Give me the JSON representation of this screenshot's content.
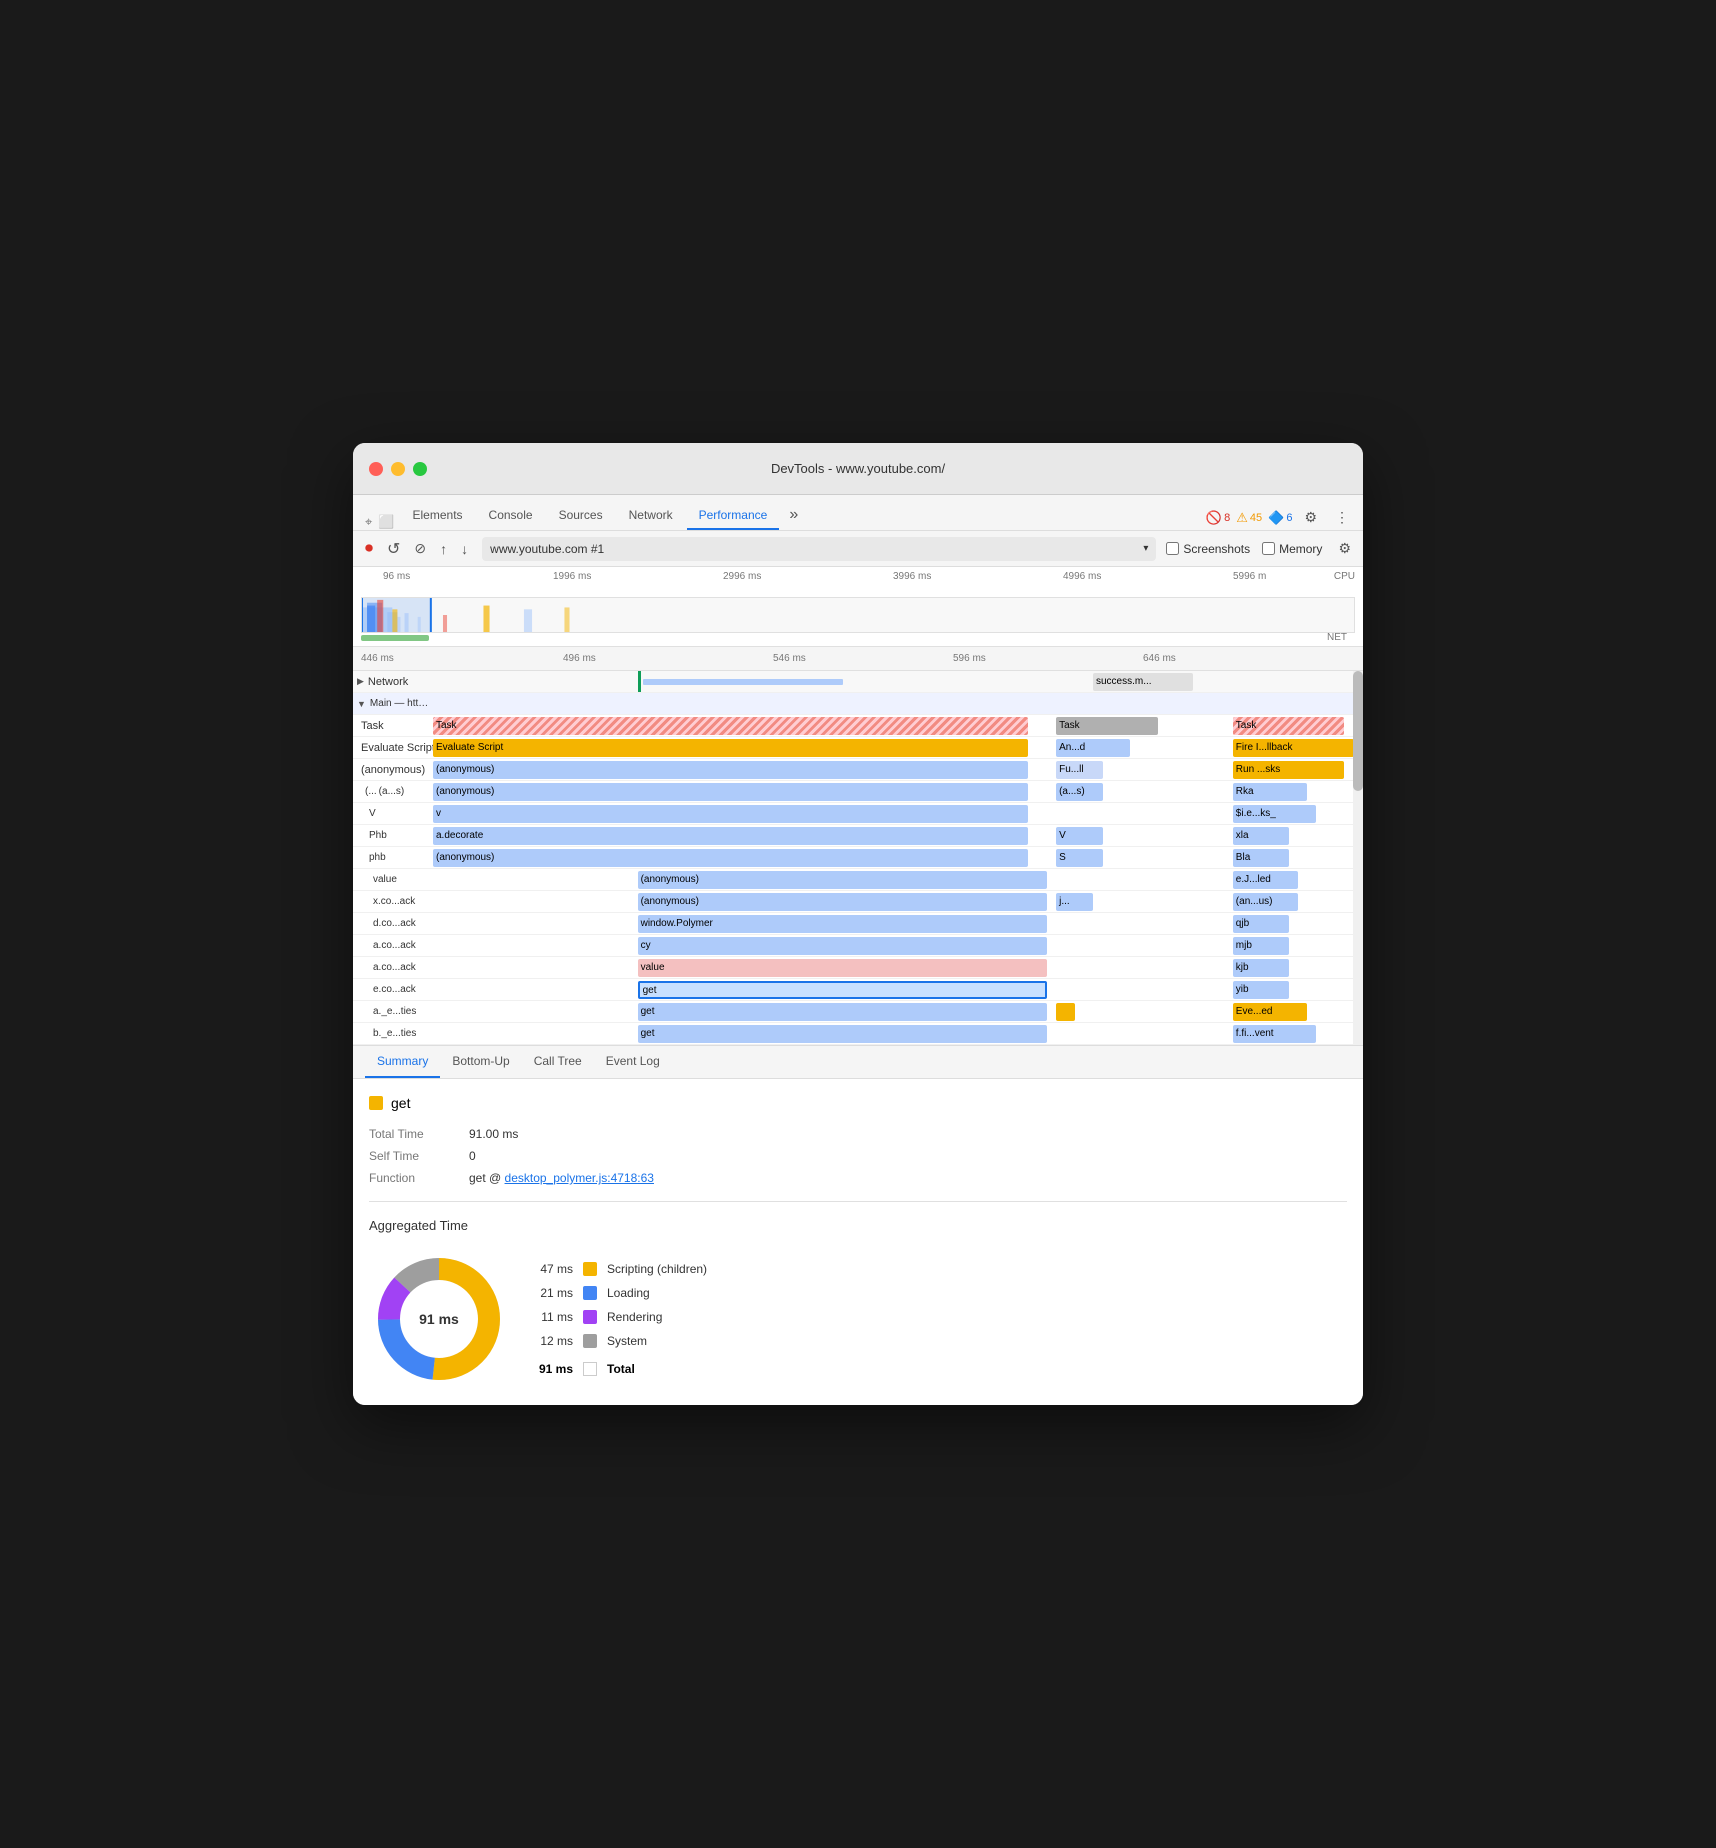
{
  "window": {
    "title": "DevTools - www.youtube.com/"
  },
  "nav_tabs": [
    {
      "label": "Elements",
      "active": false
    },
    {
      "label": "Console",
      "active": false
    },
    {
      "label": "Sources",
      "active": false
    },
    {
      "label": "Network",
      "active": false
    },
    {
      "label": "Performance",
      "active": true
    },
    {
      "label": "»",
      "active": false
    }
  ],
  "toolbar_right": {
    "errors_count": "8",
    "warnings_count": "45",
    "info_count": "6"
  },
  "recording_bar": {
    "url": "www.youtube.com #1",
    "screenshots_label": "Screenshots",
    "memory_label": "Memory"
  },
  "timeline": {
    "markers": [
      "96 ms",
      "1996 ms",
      "2996 ms",
      "3996 ms",
      "4996 ms",
      "5996 m"
    ],
    "bottom_markers": [
      "446 ms",
      "496 ms",
      "546 ms",
      "596 ms",
      "646 ms"
    ],
    "cpu_label": "CPU",
    "net_label": "NET"
  },
  "flamechart": {
    "network_label": "Network",
    "main_label": "Main — https://www.youtube.com/",
    "success_label": "success.m...",
    "rows": [
      {
        "label": "Task",
        "blocks": [
          {
            "text": "Task",
            "color": "task-striped",
            "left": "0%",
            "width": "66%"
          },
          {
            "text": "Task",
            "color": "task-gray",
            "left": "68%",
            "width": "12%"
          },
          {
            "text": "Task",
            "color": "task-striped",
            "left": "86%",
            "width": "13%"
          }
        ]
      },
      {
        "label": "Evaluate Script",
        "blocks": [
          {
            "text": "Evaluate Script",
            "color": "evaluate-script",
            "left": "0%",
            "width": "66%"
          },
          {
            "text": "An...d",
            "color": "anon-blue",
            "left": "68%",
            "width": "8%"
          },
          {
            "text": "Fire I...llback",
            "color": "evaluate-script",
            "left": "86%",
            "width": "13%"
          }
        ]
      },
      {
        "label": "(anonymous)",
        "blocks": [
          {
            "text": "(anonymous)",
            "color": "anon-blue",
            "left": "0%",
            "width": "66%"
          },
          {
            "text": "Fu...ll",
            "color": "fu-light",
            "left": "68%",
            "width": "5%"
          },
          {
            "text": "Run ...sks",
            "color": "run-tasks",
            "left": "86%",
            "width": "12%"
          }
        ]
      },
      {
        "label": "(...",
        "sub": "(a...s)",
        "blocks": [
          {
            "text": "(a...s)",
            "color": "anon-blue",
            "left": "68%",
            "width": "5%"
          },
          {
            "text": "Rka",
            "color": "anon-blue",
            "left": "88%",
            "width": "8%"
          }
        ]
      },
      {
        "label": "V",
        "blocks": [
          {
            "text": "v",
            "color": "anon-blue",
            "left": "0%",
            "width": "66%"
          },
          {
            "text": "$i.e...ks_",
            "color": "anon-blue",
            "left": "88%",
            "width": "8%"
          }
        ]
      },
      {
        "label": "Phb",
        "blocks": [
          {
            "text": "a.decorate",
            "color": "anon-blue",
            "left": "0%",
            "width": "66%"
          },
          {
            "text": "V",
            "color": "anon-blue",
            "left": "68%",
            "width": "5%"
          },
          {
            "text": "xla",
            "color": "anon-blue",
            "left": "88%",
            "width": "6%"
          }
        ]
      },
      {
        "label": "phb",
        "blocks": [
          {
            "text": "(anonymous)",
            "color": "anon-blue",
            "left": "0%",
            "width": "66%"
          },
          {
            "text": "S",
            "color": "anon-blue",
            "left": "68%",
            "width": "5%"
          },
          {
            "text": "Bla",
            "color": "anon-blue",
            "left": "88%",
            "width": "6%"
          }
        ]
      },
      {
        "label": "value",
        "blocks": [
          {
            "text": "(anonymous)",
            "color": "anon-blue",
            "left": "24%",
            "width": "42%"
          },
          {
            "text": "e.J...led",
            "color": "anon-blue",
            "left": "88%",
            "width": "6%"
          }
        ]
      },
      {
        "label": "x.co...ack",
        "blocks": [
          {
            "text": "(anonymous)",
            "color": "anon-blue",
            "left": "24%",
            "width": "42%"
          },
          {
            "text": "j...",
            "color": "anon-blue",
            "left": "68%",
            "width": "3%"
          },
          {
            "text": "(an...us)",
            "color": "anon-blue",
            "left": "88%",
            "width": "6%"
          }
        ]
      },
      {
        "label": "d.co...ack",
        "blocks": [
          {
            "text": "window.Polymer",
            "color": "anon-blue",
            "left": "24%",
            "width": "42%"
          },
          {
            "text": "qjb",
            "color": "anon-blue",
            "left": "88%",
            "width": "6%"
          }
        ]
      },
      {
        "label": "a.co...ack",
        "blocks": [
          {
            "text": "cy",
            "color": "anon-blue",
            "left": "24%",
            "width": "42%"
          },
          {
            "text": "mjb",
            "color": "anon-blue",
            "left": "88%",
            "width": "6%"
          }
        ]
      },
      {
        "label": "a.co...ack2",
        "blocks": [
          {
            "text": "value",
            "color": "pink",
            "left": "24%",
            "width": "42%"
          },
          {
            "text": "kjb",
            "color": "anon-blue",
            "left": "88%",
            "width": "6%"
          }
        ]
      },
      {
        "label": "e.co...ack",
        "blocks": [
          {
            "text": "get",
            "color": "selected",
            "left": "24%",
            "width": "42%"
          },
          {
            "text": "yib",
            "color": "anon-blue",
            "left": "88%",
            "width": "6%"
          }
        ]
      },
      {
        "label": "a._e...ties",
        "blocks": [
          {
            "text": "get",
            "color": "anon-blue",
            "left": "24%",
            "width": "42%"
          },
          {
            "text": "Eve...ed",
            "color": "evaluate-script",
            "left": "88%",
            "width": "6%"
          }
        ]
      },
      {
        "label": "b._e...ties",
        "blocks": [
          {
            "text": "get",
            "color": "anon-blue",
            "left": "24%",
            "width": "42%"
          },
          {
            "text": "f.fi...vent",
            "color": "anon-blue",
            "left": "88%",
            "width": "8%"
          }
        ]
      }
    ]
  },
  "bottom_tabs": [
    {
      "label": "Summary",
      "active": true
    },
    {
      "label": "Bottom-Up",
      "active": false
    },
    {
      "label": "Call Tree",
      "active": false
    },
    {
      "label": "Event Log",
      "active": false
    }
  ],
  "summary": {
    "title": "get",
    "total_time_label": "Total Time",
    "total_time_value": "91.00 ms",
    "self_time_label": "Self Time",
    "self_time_value": "0",
    "function_label": "Function",
    "function_text": "get @ ",
    "function_link": "desktop_polymer.js:4718:63"
  },
  "aggregated": {
    "title": "Aggregated Time",
    "donut_label": "91 ms",
    "items": [
      {
        "value": "47 ms",
        "color": "#f4b400",
        "label": "Scripting (children)"
      },
      {
        "value": "21 ms",
        "color": "#4285f4",
        "label": "Loading"
      },
      {
        "value": "11 ms",
        "color": "#a142f4",
        "label": "Rendering"
      },
      {
        "value": "12 ms",
        "color": "#9e9e9e",
        "label": "System"
      }
    ],
    "total_label": "Total",
    "total_value": "91 ms"
  }
}
